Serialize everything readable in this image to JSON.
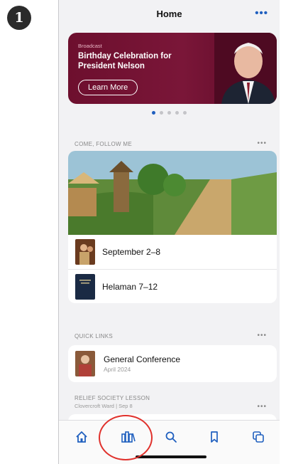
{
  "step_number": "1",
  "header": {
    "title": "Home",
    "more_icon": "more-horizontal-icon"
  },
  "banner": {
    "eyebrow": "Broadcast",
    "title": "Birthday Celebration for President Nelson",
    "button_label": "Learn More",
    "background_color": "#6d0f2e"
  },
  "carousel": {
    "count": 5,
    "active_index": 0,
    "active_color": "#1f5fbf"
  },
  "come_follow_me": {
    "label": "COME, FOLLOW ME",
    "items": [
      {
        "label": "September 2–8"
      },
      {
        "label": "Helaman 7–12"
      }
    ]
  },
  "quick_links": {
    "label": "QUICK LINKS",
    "items": [
      {
        "title": "General Conference",
        "subtitle": "April 2024"
      }
    ]
  },
  "relief_society": {
    "label": "RELIEF SOCIETY LESSON",
    "sub": "Clovercroft Ward | Sep 8"
  },
  "tabbar": {
    "tabs": [
      {
        "name": "home",
        "icon": "home-icon"
      },
      {
        "name": "library",
        "icon": "library-icon",
        "highlighted": true
      },
      {
        "name": "search",
        "icon": "search-icon"
      },
      {
        "name": "bookmarks",
        "icon": "bookmark-icon"
      },
      {
        "name": "screens",
        "icon": "screens-icon"
      }
    ],
    "active_color": "#1f5fbf"
  },
  "annotation_color": "#e0312c"
}
